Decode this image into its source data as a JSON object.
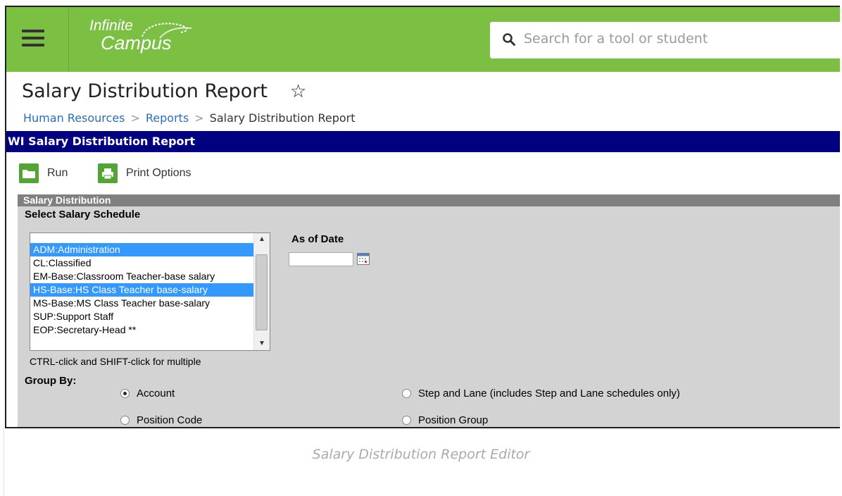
{
  "app": {
    "logo_line1": "Infinite",
    "logo_line2": "Campus",
    "search_placeholder": "Search for a tool or student"
  },
  "page": {
    "title": "Salary Distribution Report",
    "breadcrumb": [
      "Human Resources",
      "Reports",
      "Salary Distribution Report"
    ]
  },
  "report_header": "WI Salary Distribution Report",
  "toolbar": {
    "run_label": "Run",
    "print_label": "Print Options"
  },
  "section": {
    "title": "Salary Distribution",
    "schedule_label": "Select Salary Schedule",
    "schedules": [
      {
        "label": "ADM:Administration",
        "selected": true
      },
      {
        "label": "CL:Classified",
        "selected": false
      },
      {
        "label": "EM-Base:Classroom Teacher-base salary",
        "selected": false
      },
      {
        "label": "HS-Base:HS Class Teacher base-salary",
        "selected": true
      },
      {
        "label": "MS-Base:MS Class Teacher base-salary",
        "selected": false
      },
      {
        "label": "SUP:Support Staff",
        "selected": false
      },
      {
        "label": "EOP:Secretary-Head **",
        "selected": false
      }
    ],
    "multi_hint": "CTRL-click and SHIFT-click for multiple",
    "date_label": "As of Date",
    "date_value": "",
    "group_by_label": "Group By:",
    "group_options": [
      {
        "label": "Account",
        "checked": true
      },
      {
        "label": "Step and Lane (includes Step and Lane schedules only)",
        "checked": false
      },
      {
        "label": "Position Code",
        "checked": false
      },
      {
        "label": "Position Group",
        "checked": false
      }
    ]
  },
  "caption": "Salary Distribution Report Editor",
  "colors": {
    "topbar": "#7bc043",
    "report_header": "#000080",
    "selection": "#3399ff",
    "link": "#2a6ebb"
  }
}
